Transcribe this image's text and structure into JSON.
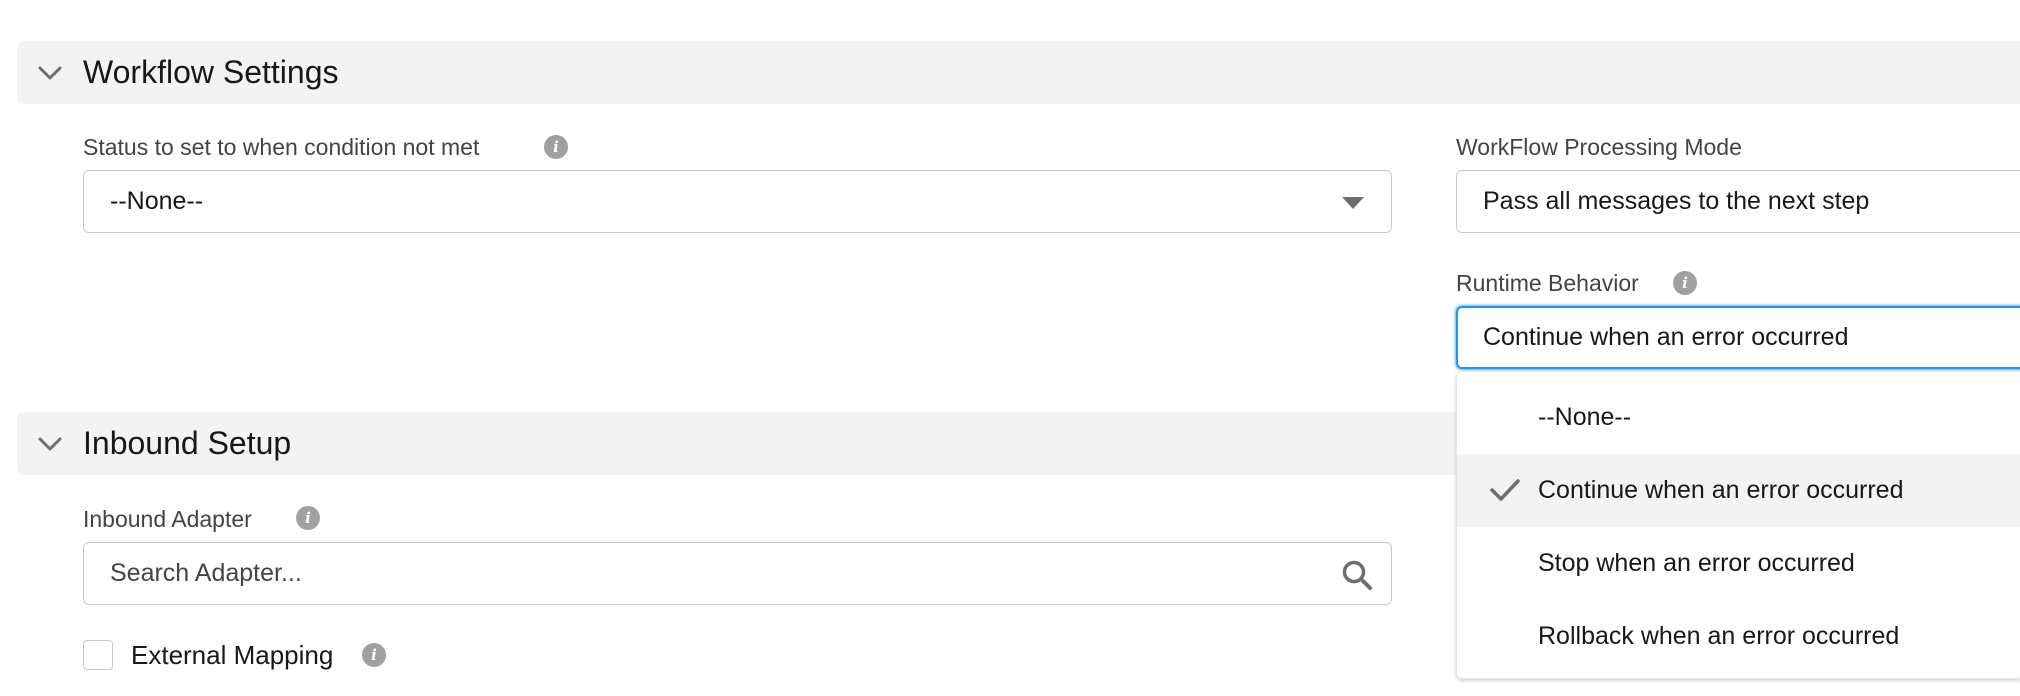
{
  "sections": {
    "workflow": {
      "title": "Workflow Settings"
    },
    "inbound": {
      "title": "Inbound Setup"
    }
  },
  "fields": {
    "status_condition": {
      "label": "Status to set to when condition not met",
      "value": "--None--"
    },
    "processing_mode": {
      "label": "WorkFlow Processing Mode",
      "value": "Pass all messages to the next step"
    },
    "runtime_behavior": {
      "label": "Runtime Behavior",
      "value": "Continue when an error occurred",
      "options": [
        {
          "label": "--None--",
          "selected": false
        },
        {
          "label": "Continue when an error occurred",
          "selected": true
        },
        {
          "label": "Stop when an error occurred",
          "selected": false
        },
        {
          "label": "Rollback when an error occurred",
          "selected": false
        }
      ]
    },
    "inbound_adapter": {
      "label": "Inbound Adapter",
      "placeholder": "Search Adapter..."
    },
    "external_mapping": {
      "label": "External Mapping",
      "checked": false
    }
  },
  "icons": {
    "info": "i",
    "chevron": "chevron-down-icon",
    "search": "search-icon",
    "check": "checkmark-icon",
    "caret": "caret-down-icon"
  },
  "colors": {
    "section_bg": "#f3f3f3",
    "focus_border": "#1b96ff",
    "icon_grey": "#706e6b"
  }
}
